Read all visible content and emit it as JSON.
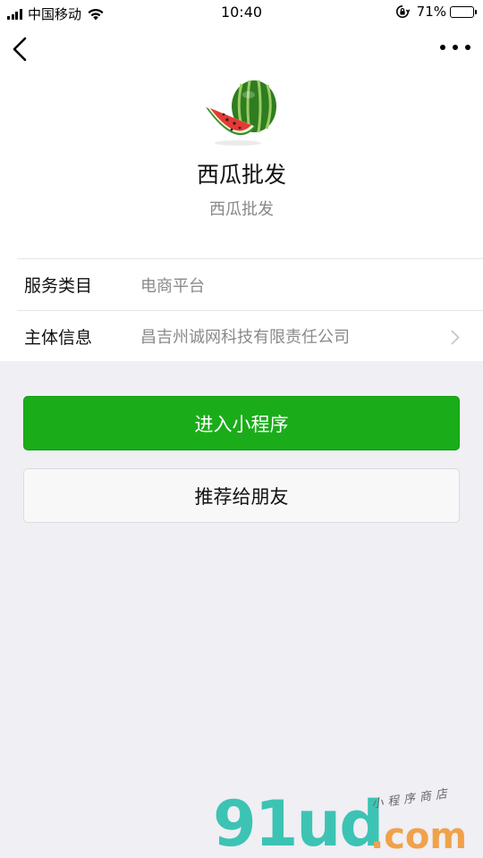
{
  "status_bar": {
    "carrier": "中国移动",
    "time": "10:40",
    "battery_percent": "71%",
    "battery_level": 0.71
  },
  "header": {
    "back_icon": "chevron-left-icon",
    "more_icon": "more-dots-icon"
  },
  "profile": {
    "logo_icon": "watermelon-logo",
    "name": "西瓜批发",
    "subtitle": "西瓜批发"
  },
  "info": {
    "rows": [
      {
        "label": "服务类目",
        "value": "电商平台"
      },
      {
        "label": "主体信息",
        "value": "昌吉州诚网科技有限责任公司"
      }
    ]
  },
  "actions": {
    "enter_label": "进入小程序",
    "recommend_label": "推荐给朋友",
    "primary_color": "#1aad19"
  },
  "watermark": {
    "main": "91ud",
    "dotcom": ".com",
    "tagline": "小程序商店"
  }
}
